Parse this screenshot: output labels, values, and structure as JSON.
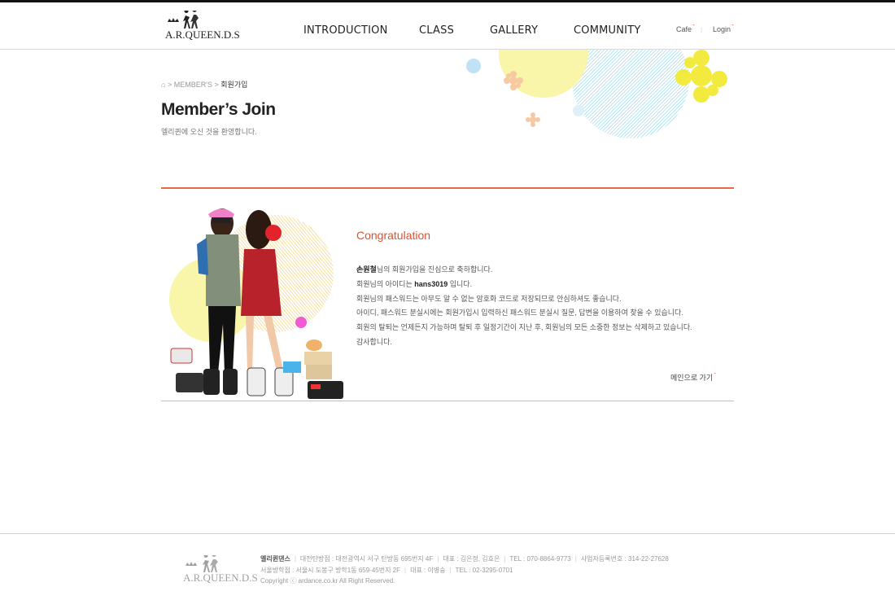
{
  "brand": {
    "logo_text": "A.R.QUEEN.D.S"
  },
  "nav": {
    "items": [
      {
        "label": "INTRODUCTION"
      },
      {
        "label": "CLASS"
      },
      {
        "label": "GALLERY"
      },
      {
        "label": "COMMUNITY"
      }
    ]
  },
  "util": {
    "cafe": "Cafe",
    "login": "Login"
  },
  "breadcrumb": {
    "section": "MEMBER'S",
    "current": "회원가입"
  },
  "page": {
    "title": "Member’s Join",
    "subtitle": "엘리퀸에 오신 것을 환영합니다."
  },
  "content": {
    "heading": "Congratulation",
    "name": "손원철",
    "line1_rest": "님의 회원가입을 진심으로 축하합니다.",
    "line2_pre": "회원님의 아이디는 ",
    "user_id": "hans3019",
    "line2_post": " 입니다.",
    "line3": "회원님의 패스워드는 아무도 알 수 없는 암호화 코드로 저장되므로 안심하셔도 좋습니다.",
    "line4": "아이디, 패스워드 분실시에는 회원가입시 입력하신 패스워드 분실시 질문, 답변을 이용하여 찾을 수 있습니다.",
    "line5": "회원의 탈퇴는 언제든지 가능하며 탈퇴 후 일정기간이 지난 후, 회원님의 모든 소중한 정보는 삭제하고 있습니다.",
    "line6": "감사합니다.",
    "main_link": "메인으로 가기"
  },
  "footer": {
    "company": "엘리퀸댄스",
    "branch1": "대전탄방점 : 대전광역시 서구 탄방동 695번지 4F",
    "rep1": "대표 : 김은정, 김효은",
    "tel1": "TEL : 070-8864-9773",
    "bizno": "사업자등록번호 : 314-22-27628",
    "branch2": "서울방학점 : 서울시 도봉구 방학1동 659-45번지 2F",
    "rep2": "대표 : 이병숭",
    "tel2": "TEL : 02-3295-0701",
    "copyright": "Copyright ⓒ ardance.co.kr  All Right Reserved."
  },
  "colors": {
    "accent": "#e0502a",
    "rule": "#e86a45",
    "pastel_yellow": "#f9f5a9",
    "pastel_blue": "#9ddcec"
  }
}
